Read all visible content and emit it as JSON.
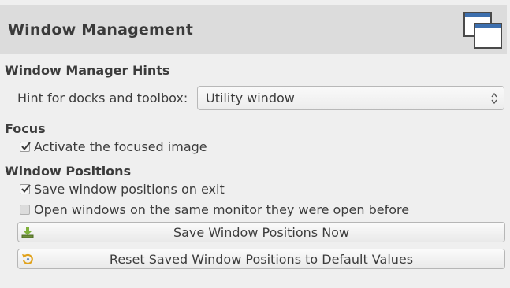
{
  "header": {
    "title": "Window Management",
    "icon": "windows-icon"
  },
  "hints": {
    "section_title": "Window Manager Hints",
    "docks_label": "Hint for docks and toolbox:",
    "docks_value": "Utility window"
  },
  "focus": {
    "section_title": "Focus",
    "activate_label": "Activate the focused image",
    "activate_checked": true
  },
  "positions": {
    "section_title": "Window Positions",
    "save_on_exit_label": "Save window positions on exit",
    "save_on_exit_checked": true,
    "same_monitor_label": "Open windows on the same monitor they were open before",
    "same_monitor_checked": false,
    "save_now_button": "Save Window Positions Now",
    "save_now_icon": "download-icon",
    "reset_button": "Reset Saved Window Positions to Default Values",
    "reset_icon": "reset-icon"
  }
}
